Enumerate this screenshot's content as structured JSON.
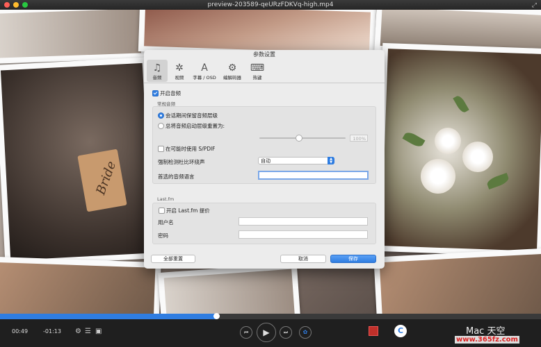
{
  "window": {
    "title": "preview-203589-qeURzFDKVq-high.mp4",
    "right_icon": "⤢"
  },
  "photo": {
    "tag_text": "Bride"
  },
  "dialog": {
    "title": "参数设置",
    "toolbar": [
      {
        "icon": "♫",
        "label": "音频"
      },
      {
        "icon": "✲",
        "label": "视频"
      },
      {
        "icon": "A",
        "label": "字幕 / OSD"
      },
      {
        "icon": "⚙",
        "label": "编解码器"
      },
      {
        "icon": "⌨",
        "label": "热键"
      }
    ],
    "enable_audio": "开启音频",
    "general_section": "常规音频",
    "radio_keep": "会话期间保留音频层级",
    "radio_reset": "总将音频启动层级重置为:",
    "volume_percent": "100%",
    "volume_level": 0.45,
    "spdif": "在可能时使用 S/PDIF",
    "force_detect_label": "强制检测杜比环绕声",
    "force_detect_value": "自动",
    "preferred_lang_label": "首选的音频语言",
    "lastfm_section": "Last.fm",
    "lastfm_enable": "开启 Last.fm 提价",
    "username_label": "用户名",
    "password_label": "密码",
    "reset_all": "全部重置",
    "cancel": "取消",
    "save": "保存"
  },
  "player": {
    "elapsed": "00:49",
    "remaining": "-01:13",
    "progress": 0.4,
    "watermark": "Mac 天空",
    "watermark_url": "www.365fz.com"
  },
  "colors": {
    "accent": "#2f7de1",
    "red": "#ff5f57",
    "yellow": "#febc2e",
    "green": "#28c840"
  }
}
